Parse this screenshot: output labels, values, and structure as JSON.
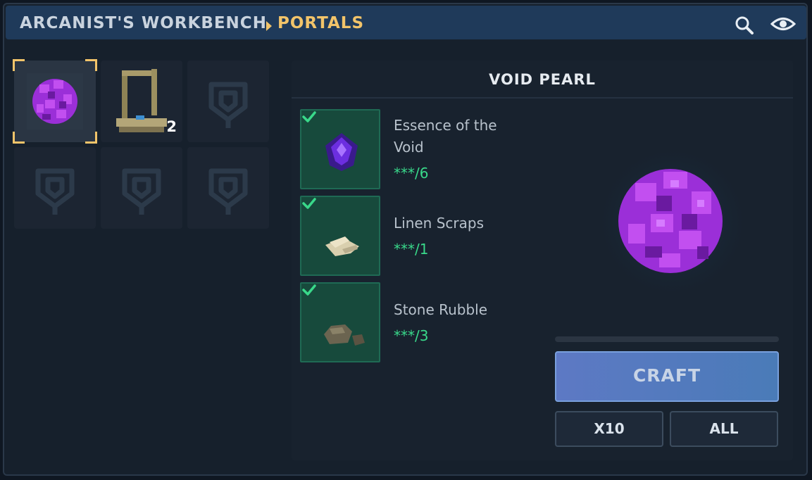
{
  "header": {
    "breadcrumb_root": "ARCANIST'S WORKBENCH",
    "breadcrumb_current": "PORTALS",
    "search_icon": "search-icon",
    "view_icon": "eye-icon"
  },
  "recipe_slots": [
    {
      "item": "Void Pearl",
      "icon": "void-pearl-icon",
      "selected": true,
      "count": ""
    },
    {
      "item": "Portal Frame",
      "icon": "portal-frame-icon",
      "selected": false,
      "count": "2"
    },
    {
      "item": "",
      "icon": "locked-rune-icon",
      "selected": false,
      "count": ""
    },
    {
      "item": "",
      "icon": "locked-rune-icon",
      "selected": false,
      "count": ""
    },
    {
      "item": "",
      "icon": "locked-rune-icon",
      "selected": false,
      "count": ""
    },
    {
      "item": "",
      "icon": "locked-rune-icon",
      "selected": false,
      "count": ""
    }
  ],
  "recipe": {
    "title": "VOID PEARL",
    "ingredients": [
      {
        "name": "Essence of the Void",
        "count": "***/6",
        "icon": "void-essence-icon",
        "satisfied": true
      },
      {
        "name": "Linen Scraps",
        "count": "***/1",
        "icon": "linen-scraps-icon",
        "satisfied": true
      },
      {
        "name": "Stone Rubble",
        "count": "***/3",
        "icon": "stone-rubble-icon",
        "satisfied": true
      }
    ],
    "preview_icon": "void-pearl-icon",
    "progress": 0
  },
  "actions": {
    "craft_label": "CRAFT",
    "x10_label": "X10",
    "all_label": "ALL"
  },
  "colors": {
    "accent_gold": "#f2c46a",
    "ingredient_ok": "#39d98a",
    "craft_button": "#5d79c4",
    "void_purple": "#9b2fd8"
  }
}
